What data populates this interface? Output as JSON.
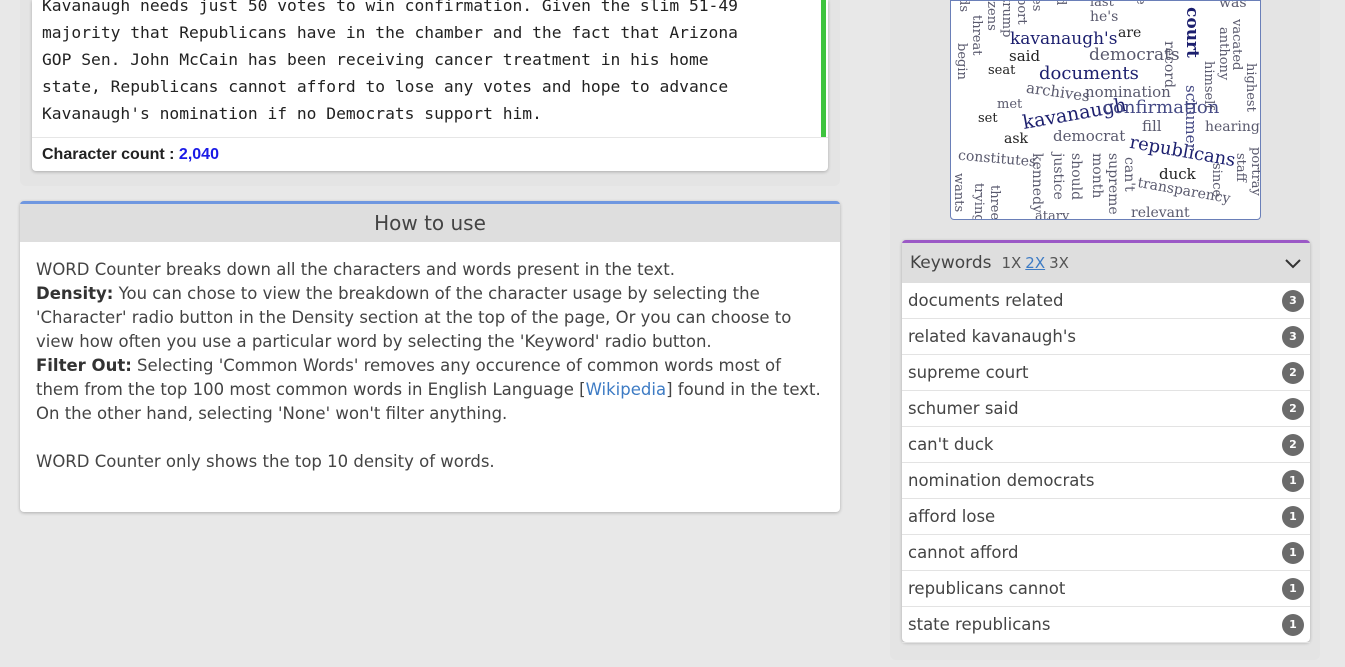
{
  "editor": {
    "lines": [
      "Kavanaugh needs just 50 votes to win confirmation. Given the slim 51-49",
      "majority that Republicans have in the chamber and the fact that Arizona",
      "GOP Sen. John McCain has been receiving cancer treatment in his home",
      "state, Republicans cannot afford to lose any votes and hope to advance",
      "Kavanaugh's nomination if no Democrats support him."
    ],
    "char_count_label": "Character count : ",
    "char_count_value": "2,040",
    "scroll_color": "#3ec43e"
  },
  "howto": {
    "title": "How to use",
    "intro": "WORD Counter breaks down all the characters and words present in the text.",
    "density_label": "Density:",
    "density_text": " You can chose to view the breakdown of the character usage by selecting the 'Character' radio button in the Density section at the top of the page, Or you can choose to view how often you use a particular word by selecting the 'Keyword' radio button.",
    "filter_label": "Filter Out:",
    "filter_text_1": " Selecting 'Common Words' removes any occurence of common words most of them from the top 100 most common words in English Language [",
    "filter_link": "Wikipedia",
    "filter_text_2": "] found in the text. On the other hand, selecting 'None' won't filter anything.",
    "footer": "WORD Counter only shows the top 10 density of words.",
    "accent_color": "#6f97e0"
  },
  "word_cloud": {
    "words": [
      "last",
      "he's",
      "was",
      "court",
      "kavanaugh's",
      "are",
      "said",
      "democrats",
      "record",
      "seat",
      "documents",
      "archives",
      "nomination",
      "met",
      "kavanaugh",
      "confirmation",
      "set",
      "fill",
      "hearings",
      "ask",
      "democrat",
      "republicans",
      "constitutes",
      "duck",
      "transparency",
      "relevant",
      "kennedy",
      "justice",
      "should",
      "month",
      "supreme",
      "can't",
      "since",
      "staff",
      "portray",
      "highest",
      "vacated",
      "anthony",
      "himself",
      "schumer",
      "begin",
      "threat",
      "wants",
      "trying",
      "three",
      "trump",
      "izens",
      "port",
      "d",
      "e",
      "ds",
      "es",
      "atary"
    ]
  },
  "keywords": {
    "title": "Keywords",
    "options": [
      "1X",
      "2X",
      "3X"
    ],
    "active_option": "2X",
    "accent_color": "#9b59c6",
    "items": [
      {
        "phrase": "documents related",
        "count": "3"
      },
      {
        "phrase": "related kavanaugh's",
        "count": "3"
      },
      {
        "phrase": "supreme court",
        "count": "2"
      },
      {
        "phrase": "schumer said",
        "count": "2"
      },
      {
        "phrase": "can't duck",
        "count": "2"
      },
      {
        "phrase": "nomination democrats",
        "count": "1"
      },
      {
        "phrase": "afford lose",
        "count": "1"
      },
      {
        "phrase": "cannot afford",
        "count": "1"
      },
      {
        "phrase": "republicans cannot",
        "count": "1"
      },
      {
        "phrase": "state republicans",
        "count": "1"
      }
    ]
  }
}
